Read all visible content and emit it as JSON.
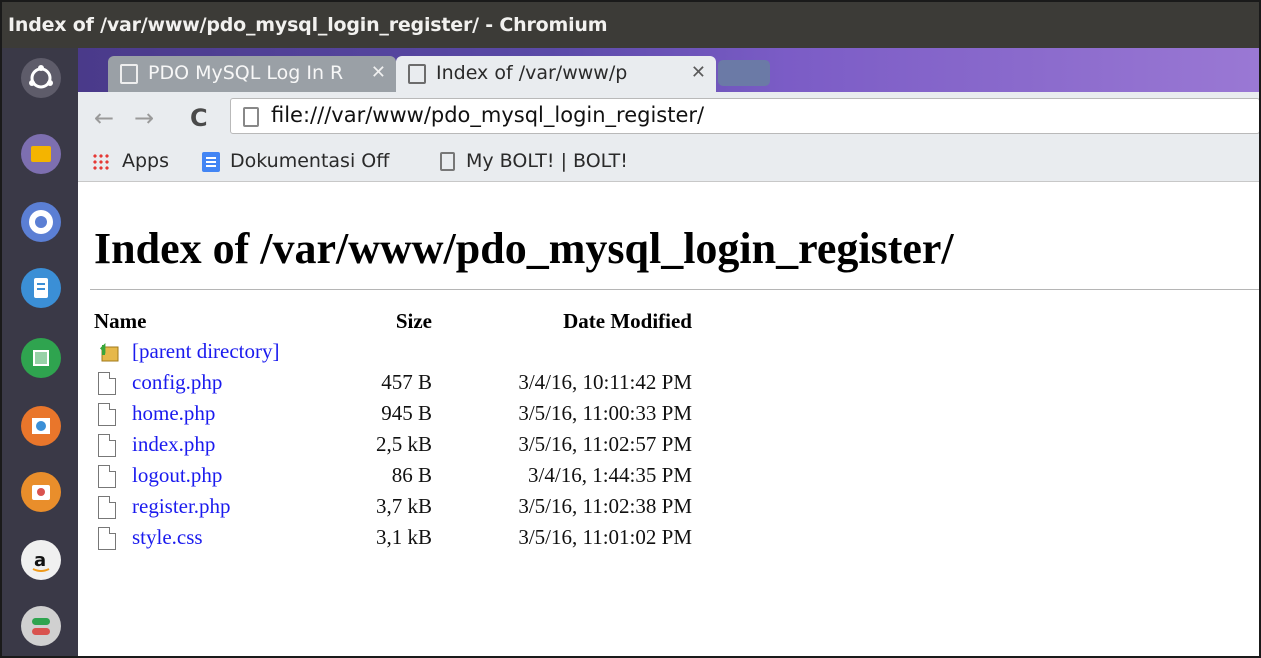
{
  "window": {
    "title": "Index of /var/www/pdo_mysql_login_register/ - Chromium"
  },
  "launcher": {
    "icons": [
      "ubuntu-icon",
      "files-icon",
      "chromium-icon",
      "writer-icon",
      "calc-icon",
      "impress-icon",
      "software-center-icon",
      "amazon-icon",
      "settings-icon"
    ]
  },
  "tabs": [
    {
      "label": "PDO MySQL Log In R",
      "active": false
    },
    {
      "label": "Index of /var/www/p",
      "active": true
    }
  ],
  "toolbar": {
    "back": "←",
    "forward": "→",
    "reload": "C",
    "url": "file:///var/www/pdo_mysql_login_register/"
  },
  "bookmarks": [
    {
      "label": "Apps",
      "icon": "apps-icon"
    },
    {
      "label": "Dokumentasi Off",
      "icon": "doc-icon"
    },
    {
      "label": "My BOLT! | BOLT!",
      "icon": "page-icon"
    }
  ],
  "page": {
    "heading": "Index of /var/www/pdo_mysql_login_register/",
    "columns": {
      "name": "Name",
      "size": "Size",
      "date": "Date Modified"
    },
    "parent": "[parent directory]",
    "files": [
      {
        "name": "config.php",
        "size": "457 B",
        "date": "3/4/16, 10:11:42 PM"
      },
      {
        "name": "home.php",
        "size": "945 B",
        "date": "3/5/16, 11:00:33 PM"
      },
      {
        "name": "index.php",
        "size": "2,5 kB",
        "date": "3/5/16, 11:02:57 PM"
      },
      {
        "name": "logout.php",
        "size": "86 B",
        "date": "3/4/16, 1:44:35 PM"
      },
      {
        "name": "register.php",
        "size": "3,7 kB",
        "date": "3/5/16, 11:02:38 PM"
      },
      {
        "name": "style.css",
        "size": "3,1 kB",
        "date": "3/5/16, 11:01:02 PM"
      }
    ]
  },
  "colors": {
    "link": "#1a1aee",
    "launcher": "#3a3947",
    "titlebar": "#3c3b37"
  }
}
